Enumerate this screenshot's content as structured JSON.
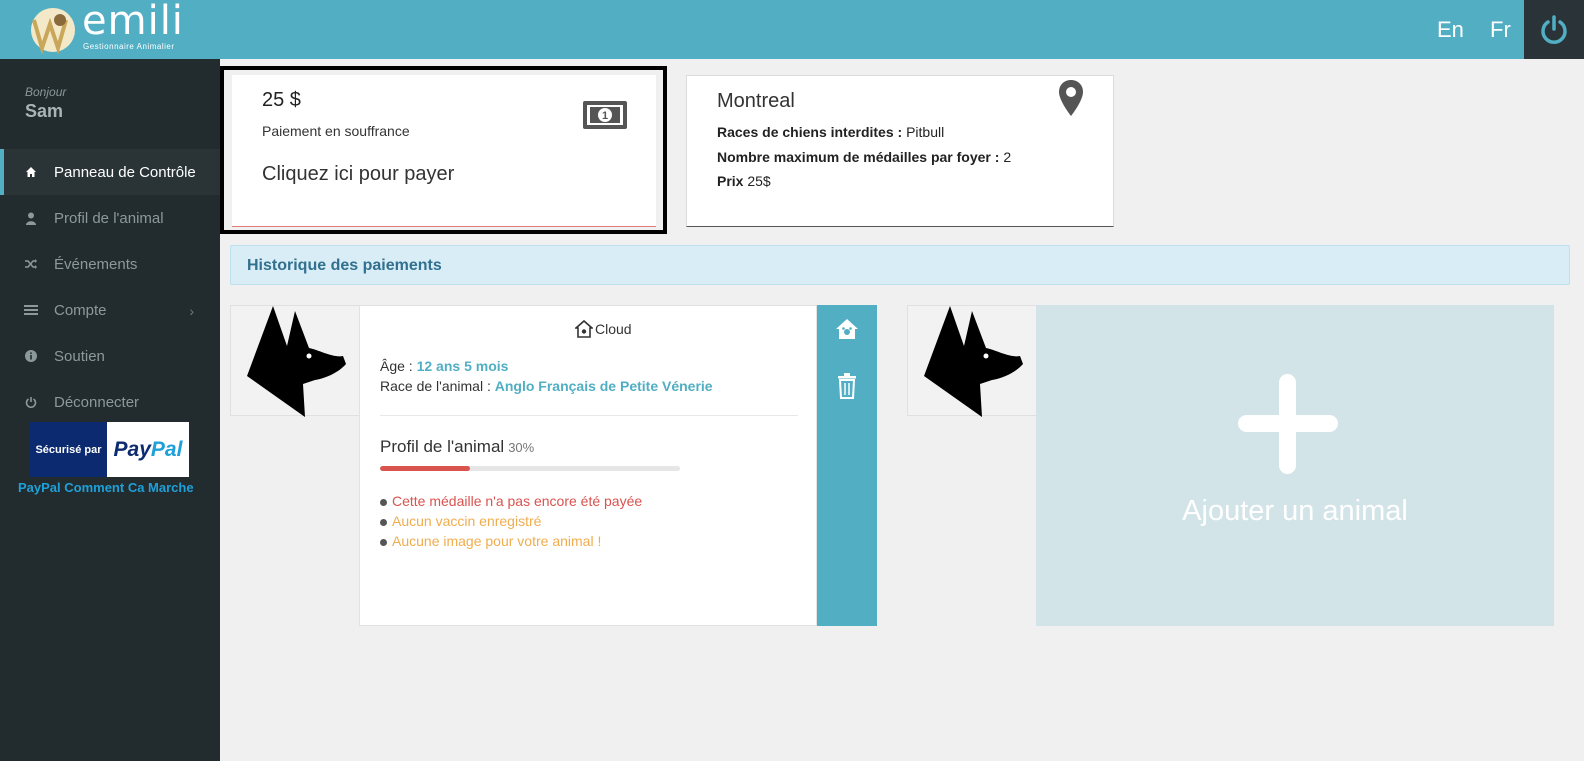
{
  "header": {
    "logo_text": "emili",
    "logo_subtitle": "Gestionnaire Animalier",
    "lang_en": "En",
    "lang_fr": "Fr",
    "accent_color": "#51aec3"
  },
  "sidebar": {
    "greeting": "Bonjour",
    "user_name": "Sam",
    "items": [
      {
        "label": "Panneau de Contrôle",
        "icon": "home-icon",
        "active": true
      },
      {
        "label": "Profil de l'animal",
        "icon": "user-icon"
      },
      {
        "label": "Événements",
        "icon": "shuffle-icon"
      },
      {
        "label": "Compte",
        "icon": "list-icon",
        "has_submenu": true
      },
      {
        "label": "Soutien",
        "icon": "info-icon"
      },
      {
        "label": "Déconnecter",
        "icon": "power-icon"
      }
    ],
    "paypal": {
      "secured_text": "Sécurisé par",
      "brand_pay": "Pay",
      "brand_pal": "Pal",
      "link_text": "PayPal Comment Ca Marche"
    }
  },
  "payment_card": {
    "amount": "25 $",
    "status": "Paiement en souffrance",
    "cta": "Cliquez ici pour payer"
  },
  "city_card": {
    "city": "Montreal",
    "banned_label": "Races de chiens interdites :",
    "banned_value": "Pitbull",
    "max_label": "Nombre maximum de médailles par foyer :",
    "max_value": "2",
    "price_label": "Prix",
    "price_value": "25$"
  },
  "history": {
    "label": "Historique des paiements"
  },
  "animal": {
    "name": "Cloud",
    "age_label": "Âge :",
    "age_value": "12 ans 5 mois",
    "breed_label": "Race de l'animal :",
    "breed_value": "Anglo Français de Petite Vénerie",
    "profile_label": "Profil de l'animal",
    "profile_pct_text": "30%",
    "profile_progress": 0.3,
    "warnings": [
      {
        "text": "Cette médaille n'a pas encore été payée",
        "color": "#d9534f"
      },
      {
        "text": "Aucun vaccin enregistré",
        "color": "#f0ad4e"
      },
      {
        "text": "Aucune image pour votre animal !",
        "color": "#f0ad4e"
      }
    ]
  },
  "add_animal": {
    "label": "Ajouter un animal"
  }
}
